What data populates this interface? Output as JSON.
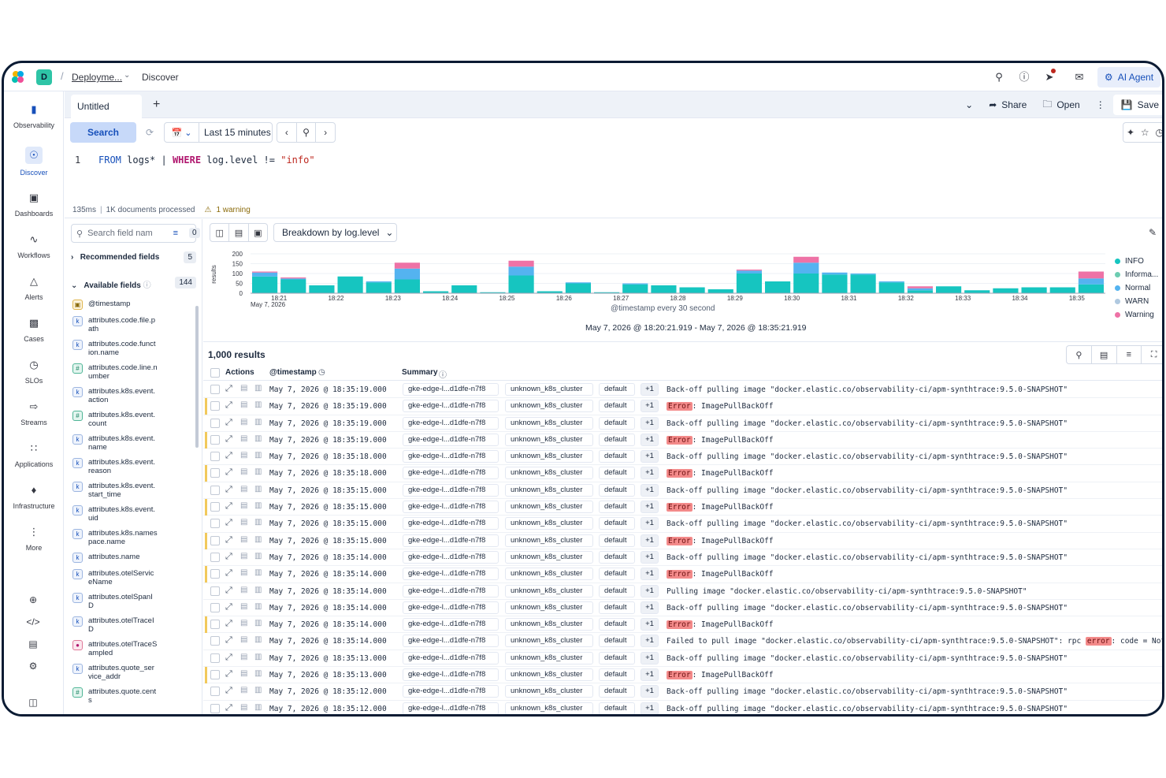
{
  "topbar": {
    "space_letter": "D",
    "breadcrumb_parent": "Deployme...",
    "breadcrumb_current": "Discover",
    "ai_agent_label": "AI Agent"
  },
  "leftnav": {
    "items": [
      {
        "label": "Observability",
        "icon": "observability-icon"
      },
      {
        "label": "Discover",
        "icon": "discover-icon",
        "active": true
      },
      {
        "label": "Dashboards",
        "icon": "dashboards-icon"
      },
      {
        "label": "Workflows",
        "icon": "workflows-icon"
      },
      {
        "label": "Alerts",
        "icon": "alerts-icon"
      },
      {
        "label": "Cases",
        "icon": "cases-icon"
      },
      {
        "label": "SLOs",
        "icon": "slos-icon"
      },
      {
        "label": "Streams",
        "icon": "streams-icon"
      },
      {
        "label": "Applications",
        "icon": "applications-icon"
      },
      {
        "label": "Infrastructure",
        "icon": "infrastructure-icon"
      },
      {
        "label": "More",
        "icon": "more-icon"
      }
    ]
  },
  "tabs": {
    "active_tab": "Untitled",
    "share_label": "Share",
    "open_label": "Open",
    "save_label": "Save"
  },
  "querybar": {
    "search_label": "Search",
    "time_range": "Last 15 minutes"
  },
  "editor": {
    "line_number": "1",
    "kw_from": "FROM",
    "source": " logs* | ",
    "kw_where": "WHERE",
    "condition": " log.level != ",
    "value": "\"info\""
  },
  "status": {
    "duration": "135ms",
    "docs_processed": "1K documents processed",
    "warning": "1 warning"
  },
  "fields": {
    "search_placeholder": "Search field nam",
    "filter_count": "0",
    "recommended_label": "Recommended fields",
    "recommended_count": "5",
    "available_label": "Available fields",
    "available_count": "144",
    "list": [
      {
        "name": "@timestamp",
        "type": "date"
      },
      {
        "name": "attributes.code.file.p\nath",
        "type": "keyword"
      },
      {
        "name": "attributes.code.funct\nion.name",
        "type": "keyword"
      },
      {
        "name": "attributes.code.line.n\number",
        "type": "number"
      },
      {
        "name": "attributes.k8s.event.\naction",
        "type": "keyword"
      },
      {
        "name": "attributes.k8s.event.\ncount",
        "type": "number"
      },
      {
        "name": "attributes.k8s.event.\nname",
        "type": "keyword"
      },
      {
        "name": "attributes.k8s.event.\nreason",
        "type": "keyword"
      },
      {
        "name": "attributes.k8s.event.\nstart_time",
        "type": "keyword"
      },
      {
        "name": "attributes.k8s.event.\nuid",
        "type": "keyword"
      },
      {
        "name": "attributes.k8s.names\npace.name",
        "type": "keyword"
      },
      {
        "name": "attributes.name",
        "type": "keyword"
      },
      {
        "name": "attributes.otelServic\neName",
        "type": "keyword"
      },
      {
        "name": "attributes.otelSpanI\nD",
        "type": "keyword"
      },
      {
        "name": "attributes.otelTraceI\nD",
        "type": "keyword"
      },
      {
        "name": "attributes.otelTraceS\nampled",
        "type": "boolean"
      },
      {
        "name": "attributes.quote_ser\nvice_addr",
        "type": "keyword"
      },
      {
        "name": "attributes.quote.cent\ns",
        "type": "number"
      }
    ]
  },
  "chart": {
    "breakdown_label": "Breakdown by log.level",
    "x_title": "@timestamp every 30 second",
    "range_text": "May 7, 2026 @ 18:20:21.919 - May 7, 2026 @ 18:35:21.919",
    "date_label": "May 7, 2026"
  },
  "chart_data": {
    "type": "bar",
    "title": "",
    "xlabel": "@timestamp every 30 second",
    "ylabel": "results",
    "ylim": [
      0,
      200
    ],
    "yticks": [
      0,
      50,
      100,
      150,
      200
    ],
    "tick_labels": [
      "18:21",
      "18:22",
      "18:23",
      "18:24",
      "18:25",
      "18:26",
      "18:27",
      "18:28",
      "18:29",
      "18:30",
      "18:31",
      "18:32",
      "18:33",
      "18:34",
      "18:35"
    ],
    "categories": [
      "18:20:30",
      "18:21:00",
      "18:21:30",
      "18:22:00",
      "18:22:30",
      "18:23:00",
      "18:23:30",
      "18:24:00",
      "18:24:30",
      "18:25:00",
      "18:25:30",
      "18:26:00",
      "18:26:30",
      "18:27:00",
      "18:27:30",
      "18:28:00",
      "18:28:30",
      "18:29:00",
      "18:29:30",
      "18:30:00",
      "18:30:30",
      "18:31:00",
      "18:31:30",
      "18:32:00",
      "18:32:30",
      "18:33:00",
      "18:33:30",
      "18:34:00",
      "18:34:30",
      "18:35:00"
    ],
    "series": [
      {
        "name": "INFO",
        "color": "#16c5c0",
        "values": [
          85,
          70,
          40,
          85,
          55,
          70,
          10,
          40,
          5,
          90,
          10,
          50,
          5,
          45,
          40,
          30,
          20,
          100,
          60,
          100,
          95,
          95,
          55,
          15,
          35,
          15,
          25,
          30,
          30,
          45
        ]
      },
      {
        "name": "Informa...",
        "color": "#6dccb1",
        "values": [
          0,
          0,
          0,
          0,
          0,
          0,
          0,
          0,
          0,
          0,
          0,
          0,
          0,
          0,
          0,
          0,
          0,
          0,
          0,
          0,
          0,
          0,
          0,
          0,
          0,
          0,
          0,
          0,
          0,
          0
        ]
      },
      {
        "name": "Normal",
        "color": "#54b3f0",
        "values": [
          20,
          5,
          0,
          0,
          5,
          55,
          0,
          0,
          0,
          45,
          0,
          5,
          0,
          5,
          0,
          0,
          0,
          15,
          0,
          55,
          10,
          5,
          5,
          10,
          0,
          0,
          0,
          0,
          0,
          30
        ]
      },
      {
        "name": "WARN",
        "color": "#b0c9e0",
        "values": [
          0,
          0,
          0,
          0,
          0,
          0,
          0,
          0,
          0,
          0,
          0,
          0,
          0,
          0,
          0,
          0,
          0,
          0,
          0,
          0,
          0,
          0,
          0,
          0,
          0,
          0,
          0,
          0,
          0,
          0
        ]
      },
      {
        "name": "Warning",
        "color": "#ee72a6",
        "values": [
          5,
          5,
          0,
          0,
          0,
          30,
          0,
          0,
          0,
          30,
          0,
          0,
          0,
          0,
          0,
          0,
          0,
          5,
          0,
          30,
          0,
          0,
          0,
          10,
          0,
          0,
          0,
          0,
          0,
          35
        ]
      }
    ]
  },
  "results": {
    "count_label": "1,000 results",
    "col_actions": "Actions",
    "col_timestamp": "@timestamp",
    "col_summary": "Summary",
    "rows": [
      {
        "flag": false,
        "ts": "May 7, 2026 @ 18:35:19.000",
        "host": "gke-edge-l...d1dfe-n7f8",
        "cluster": "unknown_k8s_cluster",
        "ns": "default",
        "more": "+1",
        "msg_pre": "Back-off pulling image \"docker.elastic.co/observability-ci/apm-synthtrace:9.5.0-SNAPSHOT\"",
        "hl": "",
        "msg_post": ""
      },
      {
        "flag": true,
        "ts": "May 7, 2026 @ 18:35:19.000",
        "host": "gke-edge-l...d1dfe-n7f8",
        "cluster": "unknown_k8s_cluster",
        "ns": "default",
        "more": "+1",
        "msg_pre": "",
        "hl": "Error",
        "msg_post": ": ImagePullBackOff"
      },
      {
        "flag": false,
        "ts": "May 7, 2026 @ 18:35:19.000",
        "host": "gke-edge-l...d1dfe-n7f8",
        "cluster": "unknown_k8s_cluster",
        "ns": "default",
        "more": "+1",
        "msg_pre": "Back-off pulling image \"docker.elastic.co/observability-ci/apm-synthtrace:9.5.0-SNAPSHOT\"",
        "hl": "",
        "msg_post": ""
      },
      {
        "flag": true,
        "ts": "May 7, 2026 @ 18:35:19.000",
        "host": "gke-edge-l...d1dfe-n7f8",
        "cluster": "unknown_k8s_cluster",
        "ns": "default",
        "more": "+1",
        "msg_pre": "",
        "hl": "Error",
        "msg_post": ": ImagePullBackOff"
      },
      {
        "flag": false,
        "ts": "May 7, 2026 @ 18:35:18.000",
        "host": "gke-edge-l...d1dfe-n7f8",
        "cluster": "unknown_k8s_cluster",
        "ns": "default",
        "more": "+1",
        "msg_pre": "Back-off pulling image \"docker.elastic.co/observability-ci/apm-synthtrace:9.5.0-SNAPSHOT\"",
        "hl": "",
        "msg_post": ""
      },
      {
        "flag": true,
        "ts": "May 7, 2026 @ 18:35:18.000",
        "host": "gke-edge-l...d1dfe-n7f8",
        "cluster": "unknown_k8s_cluster",
        "ns": "default",
        "more": "+1",
        "msg_pre": "",
        "hl": "Error",
        "msg_post": ": ImagePullBackOff"
      },
      {
        "flag": false,
        "ts": "May 7, 2026 @ 18:35:15.000",
        "host": "gke-edge-l...d1dfe-n7f8",
        "cluster": "unknown_k8s_cluster",
        "ns": "default",
        "more": "+1",
        "msg_pre": "Back-off pulling image \"docker.elastic.co/observability-ci/apm-synthtrace:9.5.0-SNAPSHOT\"",
        "hl": "",
        "msg_post": ""
      },
      {
        "flag": true,
        "ts": "May 7, 2026 @ 18:35:15.000",
        "host": "gke-edge-l...d1dfe-n7f8",
        "cluster": "unknown_k8s_cluster",
        "ns": "default",
        "more": "+1",
        "msg_pre": "",
        "hl": "Error",
        "msg_post": ": ImagePullBackOff"
      },
      {
        "flag": false,
        "ts": "May 7, 2026 @ 18:35:15.000",
        "host": "gke-edge-l...d1dfe-n7f8",
        "cluster": "unknown_k8s_cluster",
        "ns": "default",
        "more": "+1",
        "msg_pre": "Back-off pulling image \"docker.elastic.co/observability-ci/apm-synthtrace:9.5.0-SNAPSHOT\"",
        "hl": "",
        "msg_post": ""
      },
      {
        "flag": true,
        "ts": "May 7, 2026 @ 18:35:15.000",
        "host": "gke-edge-l...d1dfe-n7f8",
        "cluster": "unknown_k8s_cluster",
        "ns": "default",
        "more": "+1",
        "msg_pre": "",
        "hl": "Error",
        "msg_post": ": ImagePullBackOff"
      },
      {
        "flag": false,
        "ts": "May 7, 2026 @ 18:35:14.000",
        "host": "gke-edge-l...d1dfe-n7f8",
        "cluster": "unknown_k8s_cluster",
        "ns": "default",
        "more": "+1",
        "msg_pre": "Back-off pulling image \"docker.elastic.co/observability-ci/apm-synthtrace:9.5.0-SNAPSHOT\"",
        "hl": "",
        "msg_post": ""
      },
      {
        "flag": true,
        "ts": "May 7, 2026 @ 18:35:14.000",
        "host": "gke-edge-l...d1dfe-n7f8",
        "cluster": "unknown_k8s_cluster",
        "ns": "default",
        "more": "+1",
        "msg_pre": "",
        "hl": "Error",
        "msg_post": ": ImagePullBackOff"
      },
      {
        "flag": false,
        "ts": "May 7, 2026 @ 18:35:14.000",
        "host": "gke-edge-l...d1dfe-n7f8",
        "cluster": "unknown_k8s_cluster",
        "ns": "default",
        "more": "+1",
        "msg_pre": "Pulling image \"docker.elastic.co/observability-ci/apm-synthtrace:9.5.0-SNAPSHOT\"",
        "hl": "",
        "msg_post": ""
      },
      {
        "flag": false,
        "ts": "May 7, 2026 @ 18:35:14.000",
        "host": "gke-edge-l...d1dfe-n7f8",
        "cluster": "unknown_k8s_cluster",
        "ns": "default",
        "more": "+1",
        "msg_pre": "Back-off pulling image \"docker.elastic.co/observability-ci/apm-synthtrace:9.5.0-SNAPSHOT\"",
        "hl": "",
        "msg_post": ""
      },
      {
        "flag": true,
        "ts": "May 7, 2026 @ 18:35:14.000",
        "host": "gke-edge-l...d1dfe-n7f8",
        "cluster": "unknown_k8s_cluster",
        "ns": "default",
        "more": "+1",
        "msg_pre": "",
        "hl": "Error",
        "msg_post": ": ImagePullBackOff"
      },
      {
        "flag": false,
        "ts": "May 7, 2026 @ 18:35:14.000",
        "host": "gke-edge-l...d1dfe-n7f8",
        "cluster": "unknown_k8s_cluster",
        "ns": "default",
        "more": "+1",
        "msg_pre": "Failed to pull image \"docker.elastic.co/observability-ci/apm-synthtrace:9.5.0-SNAPSHOT\": rpc ",
        "hl": "error",
        "msg_post": ": code = NotFo"
      },
      {
        "flag": false,
        "ts": "May 7, 2026 @ 18:35:13.000",
        "host": "gke-edge-l...d1dfe-n7f8",
        "cluster": "unknown_k8s_cluster",
        "ns": "default",
        "more": "+1",
        "msg_pre": "Back-off pulling image \"docker.elastic.co/observability-ci/apm-synthtrace:9.5.0-SNAPSHOT\"",
        "hl": "",
        "msg_post": ""
      },
      {
        "flag": true,
        "ts": "May 7, 2026 @ 18:35:13.000",
        "host": "gke-edge-l...d1dfe-n7f8",
        "cluster": "unknown_k8s_cluster",
        "ns": "default",
        "more": "+1",
        "msg_pre": "",
        "hl": "Error",
        "msg_post": ": ImagePullBackOff"
      },
      {
        "flag": false,
        "ts": "May 7, 2026 @ 18:35:12.000",
        "host": "gke-edge-l...d1dfe-n7f8",
        "cluster": "unknown_k8s_cluster",
        "ns": "default",
        "more": "+1",
        "msg_pre": "Back-off pulling image \"docker.elastic.co/observability-ci/apm-synthtrace:9.5.0-SNAPSHOT\"",
        "hl": "",
        "msg_post": ""
      },
      {
        "flag": false,
        "ts": "May 7, 2026 @ 18:35:12.000",
        "host": "gke-edge-l...d1dfe-n7f8",
        "cluster": "unknown_k8s_cluster",
        "ns": "default",
        "more": "+1",
        "msg_pre": "Back-off pulling image \"docker.elastic.co/observability-ci/apm-synthtrace:9.5.0-SNAPSHOT\"",
        "hl": "",
        "msg_post": ""
      }
    ]
  }
}
